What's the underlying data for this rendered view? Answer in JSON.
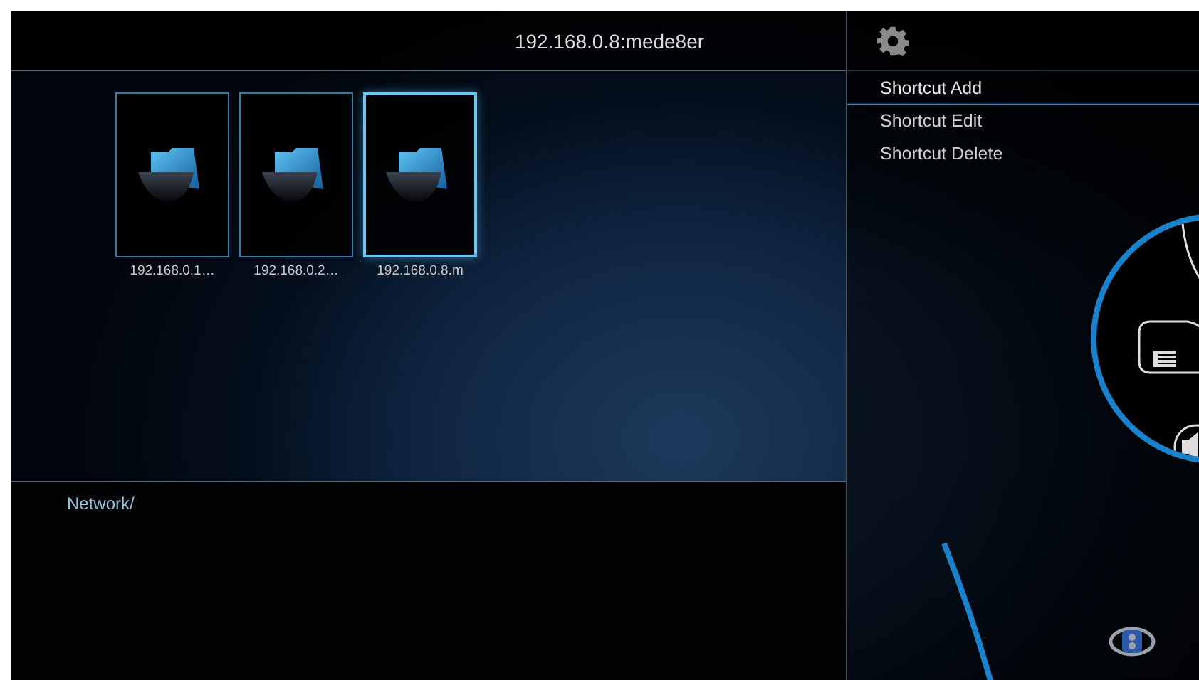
{
  "header": {
    "title": "192.168.0.8:mede8er"
  },
  "files": [
    {
      "name": "192.168.0.1…",
      "selected": false
    },
    {
      "name": "192.168.0.2…",
      "selected": false
    },
    {
      "name": "192.168.0.8.m",
      "selected": true
    }
  ],
  "path": "Network/",
  "menu": {
    "items": [
      {
        "label": "Shortcut Add",
        "selected": true
      },
      {
        "label": "Shortcut Edit",
        "selected": false
      },
      {
        "label": "Shortcut Delete",
        "selected": false
      }
    ]
  }
}
